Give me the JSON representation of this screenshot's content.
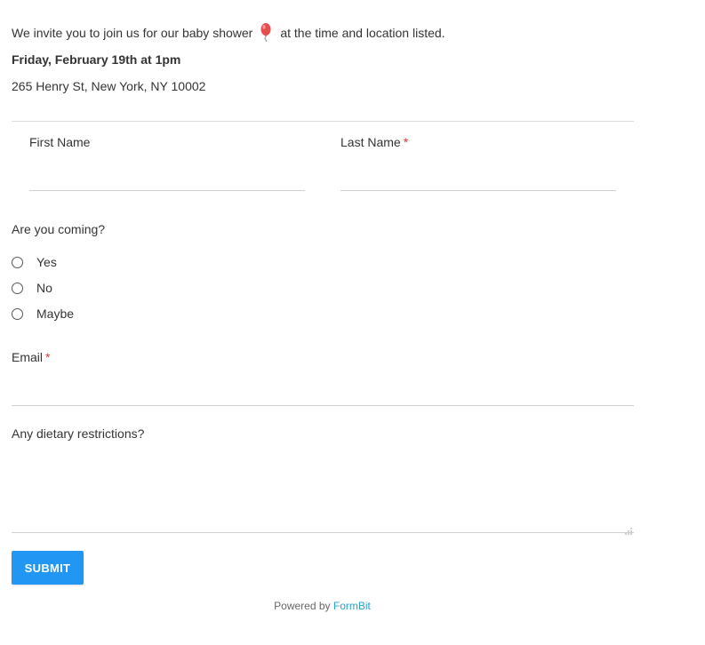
{
  "intro": {
    "text_before": "We invite you to join us for our baby shower",
    "icon": "balloon-icon",
    "text_after": "at the time and location listed."
  },
  "event": {
    "date_time": "Friday, February 19th at 1pm",
    "address": "265 Henry St, New York, NY 10002"
  },
  "form": {
    "first_name_label": "First Name",
    "last_name_label": "Last Name",
    "required_marker": "*",
    "first_name_value": "",
    "last_name_value": "",
    "coming_label": "Are you coming?",
    "coming_options": [
      "Yes",
      "No",
      "Maybe"
    ],
    "email_label": "Email",
    "email_value": "",
    "dietary_label": "Any dietary restrictions?",
    "dietary_value": "",
    "submit_label": "SUBMIT"
  },
  "footer": {
    "powered_by": "Powered by",
    "brand": "FormBit"
  },
  "colors": {
    "accent": "#2196f3",
    "required": "#e53935",
    "link": "#26a3c9",
    "balloon": "#e84d4d"
  }
}
